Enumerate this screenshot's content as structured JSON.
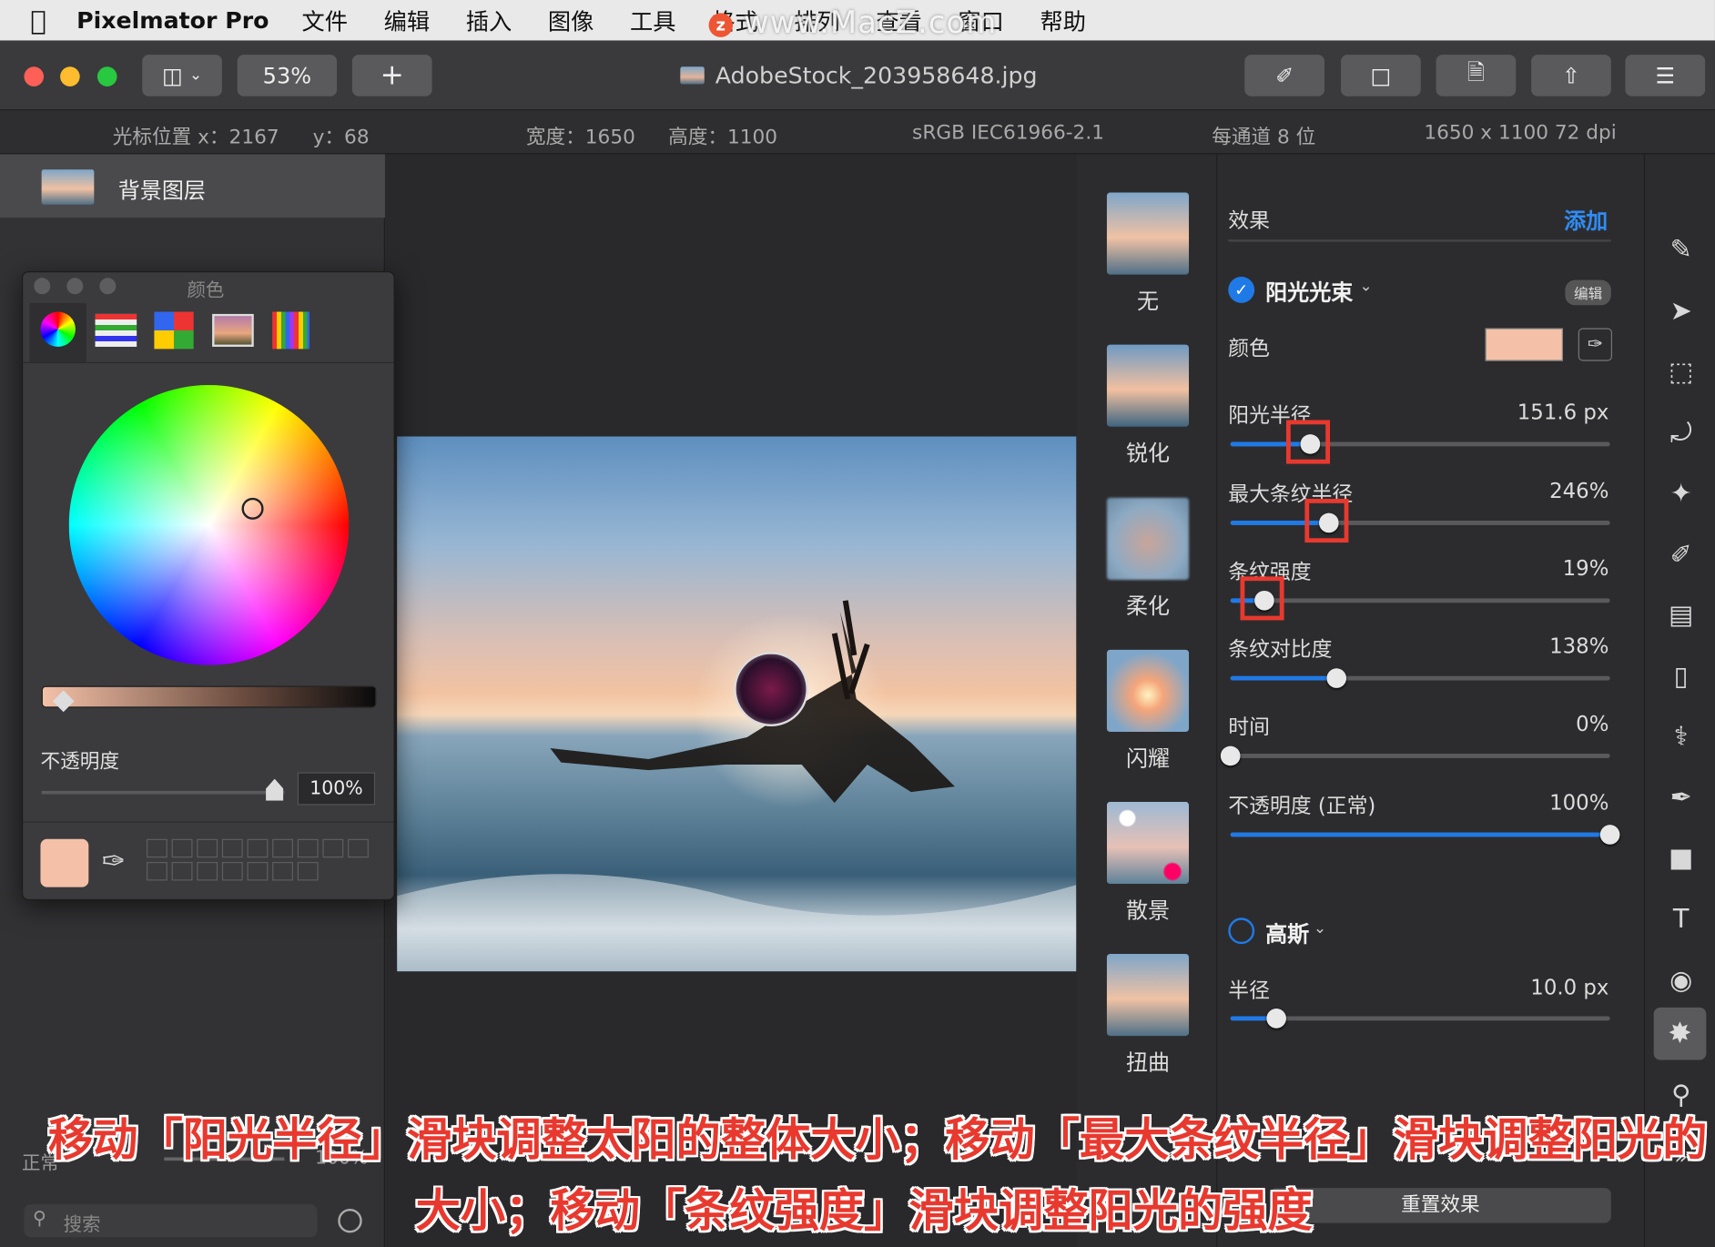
{
  "menubar": {
    "app": "Pixelmator Pro",
    "items": [
      "文件",
      "编辑",
      "插入",
      "图像",
      "工具",
      "格式",
      "排列",
      "查看",
      "窗口",
      "帮助"
    ],
    "watermark": "www.MacZ.com",
    "watermark_logo": "z"
  },
  "toolbar": {
    "zoom": "53%",
    "add": "+",
    "doc_title": "AdobeStock_203958648.jpg"
  },
  "infobar": {
    "cursor_x": "光标位置 x：2167",
    "cursor_y": "y：68",
    "width": "宽度：1650",
    "height": "高度：1100",
    "profile": "sRGB IEC61966-2.1",
    "bits": "每通道 8 位",
    "size": "1650 x 1100 72 dpi"
  },
  "layers": {
    "layer_name": "背景图层",
    "blend_mode": "正常",
    "opacity": "100%",
    "search_placeholder": "搜索"
  },
  "color_window": {
    "title": "颜色",
    "opacity_label": "不透明度",
    "opacity_value": "100%",
    "opacity_level": 0.96,
    "current_color": "#f4c1a8"
  },
  "effects_browser": {
    "items": [
      "无",
      "锐化",
      "柔化",
      "闪耀",
      "散景",
      "扭曲"
    ]
  },
  "fx_settings": {
    "header": "效果",
    "add": "添加",
    "effect1": {
      "name": "阳光光束",
      "edit": "编辑",
      "color_label": "颜色",
      "color_value": "#f4c1a8",
      "sliders": [
        {
          "label": "阳光半径",
          "value": "151.6 px",
          "level": 0.21
        },
        {
          "label": "最大条纹半径",
          "value": "246%",
          "level": 0.26
        },
        {
          "label": "条纹强度",
          "value": "19%",
          "level": 0.09
        },
        {
          "label": "条纹对比度",
          "value": "138%",
          "level": 0.28
        },
        {
          "label": "时间",
          "value": "0%",
          "level": 0.0
        },
        {
          "label": "不透明度 (正常)",
          "value": "100%",
          "level": 1.0
        }
      ]
    },
    "effect2": {
      "name": "高斯",
      "radius_label": "半径",
      "radius_value": "10.0 px",
      "radius_level": 0.12
    },
    "reset": "重置效果"
  },
  "caption": {
    "line1": "移动「阳光半径」滑块调整太阳的整体大小；移动「最大条纹半径」滑块调整阳光的",
    "line2": "大小；移动「条纹强度」滑块调整阳光的强度"
  },
  "colors": {
    "accent": "#1f7ae8",
    "highlight_box": "#e8392f"
  }
}
